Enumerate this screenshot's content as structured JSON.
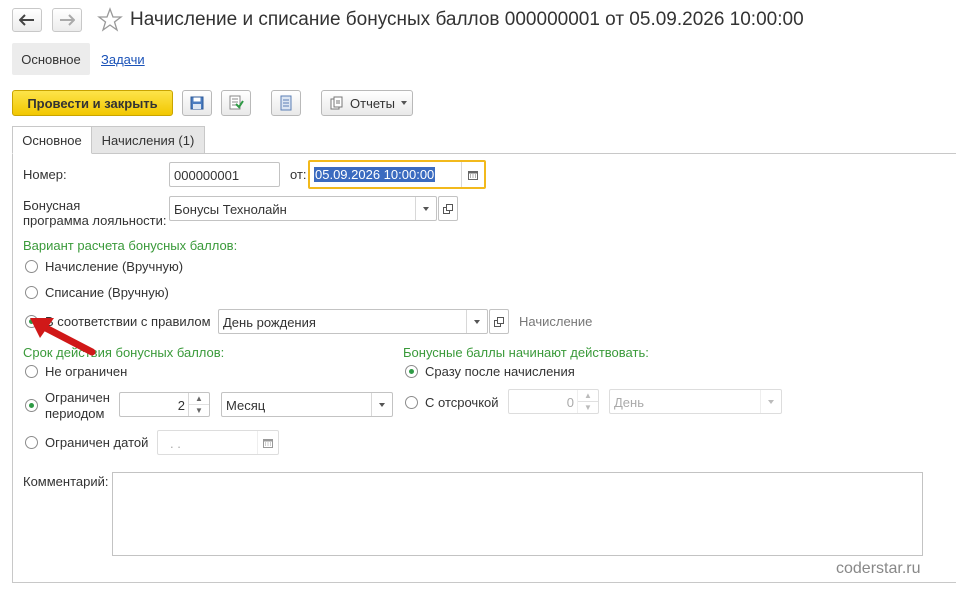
{
  "window": {
    "title": "Начисление и списание бонусных баллов 000000001 от 05.09.2026 10:00:00"
  },
  "topnav": {
    "main": "Основное",
    "tasks": "Задачи"
  },
  "toolbar": {
    "post_close": "Провести и закрыть",
    "reports": "Отчеты"
  },
  "tabs": [
    {
      "label": "Основное"
    },
    {
      "label": "Начисления (1)"
    }
  ],
  "form": {
    "number_label": "Номер:",
    "number_value": "000000001",
    "date_label": "от:",
    "date_value": "05.09.2026 10:00:00",
    "program_label_1": "Бонусная",
    "program_label_2": "программа лояльности:",
    "program_value": "Бонусы Технолайн",
    "calc_section": "Вариант расчета бонусных баллов:",
    "calc_options": [
      {
        "label": "Начисление (Вручную)"
      },
      {
        "label": "Списание (Вручную)"
      },
      {
        "label": "В соответствии с правилом"
      }
    ],
    "rule_value": "День рождения",
    "rule_kind": "Начисление",
    "validity_section": "Срок действия бонусных баллов:",
    "validity_unlimited": "Не ограничен",
    "validity_period_1": "Ограничен",
    "validity_period_2": "периодом",
    "period_value": "2",
    "period_unit": "Месяц",
    "validity_date": "Ограничен датой",
    "date_empty": ". .",
    "start_section": "Бонусные баллы начинают действовать:",
    "start_immediately": "Сразу после начисления",
    "start_delay": "С отсрочкой",
    "delay_value": "0",
    "delay_unit": "День",
    "comment_label": "Комментарий:"
  },
  "watermark": "coderstar.ru",
  "colors": {
    "accent_green": "#3a9a3a",
    "primary_button": "#f5cc0a",
    "focus_border": "#f2b91c",
    "selection": "#3b6bc0",
    "arrow": "#d01818"
  }
}
